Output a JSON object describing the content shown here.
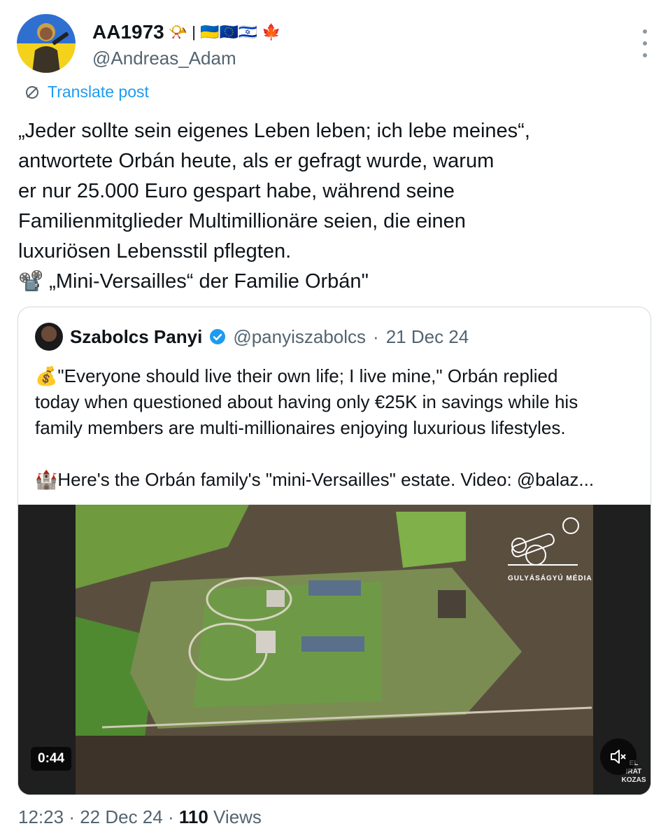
{
  "author": {
    "name": "AA1973",
    "name_suffix": "📯 | 🇺🇦🇪🇺🇮🇱 🍁",
    "handle": "@Andreas_Adam"
  },
  "translate_label": "Translate post",
  "post_lines": [
    "„Jeder sollte sein eigenes Leben leben; ich lebe meines“,",
    "antwortete Orbán heute, als er gefragt wurde, warum",
    "er nur 25.000 Euro gespart habe, während seine",
    "Familienmitglieder Multimillionäre seien, die einen",
    "luxuriösen Lebensstil pflegten.",
    "📽️ „Mini-Versailles“ der Familie Orbán\""
  ],
  "quoted": {
    "name": "Szabolcs Panyi",
    "handle": "@panyiszabolcs",
    "date": "21 Dec 24",
    "lines": [
      "💰\"Everyone should live their own life; I live mine,\" Orbán replied",
      "today when questioned about having only €25K in savings while his",
      "family members are multi-millionaires enjoying luxurious lifestyles.",
      "",
      "🏰Here's the Orbán family's \"mini-Versailles\" estate. Video: @balaz..."
    ],
    "video": {
      "duration": "0:44",
      "watermark": "GULYÁSÁGYÚ MÉDIA",
      "corner_text": "EL IRAT KOZAS"
    }
  },
  "meta": {
    "time": "12:23",
    "date": "22 Dec 24",
    "views_count": "110",
    "views_label": "Views"
  },
  "colors": {
    "accent": "#1d9bf0",
    "text": "#0f1419",
    "muted": "#536471",
    "border": "#cfd9de",
    "verified": "#1d9bf0"
  }
}
